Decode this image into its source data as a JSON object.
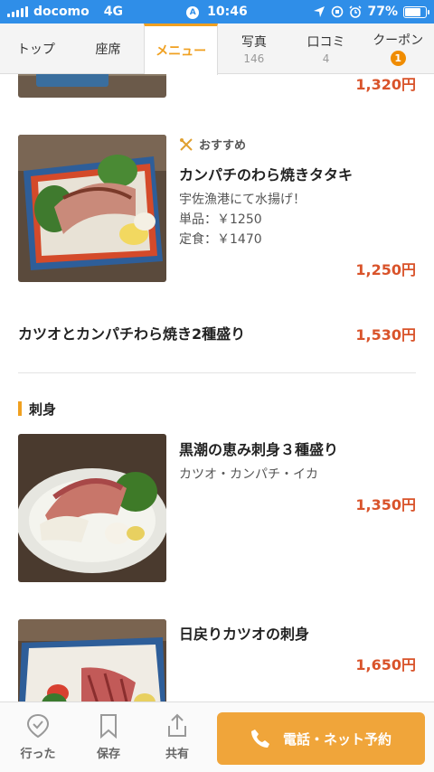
{
  "status": {
    "carrier": "docomo",
    "network": "4G",
    "time": "10:46",
    "battery": "77%",
    "battery_level": 0.77
  },
  "tabs": [
    {
      "label": "トップ",
      "count": ""
    },
    {
      "label": "座席",
      "count": ""
    },
    {
      "label": "メニュー",
      "count": ""
    },
    {
      "label": "写真",
      "count": "146"
    },
    {
      "label": "口コミ",
      "count": "4"
    },
    {
      "label": "クーポン",
      "badge": "1"
    }
  ],
  "menu": {
    "prev_item_price": "1,320円",
    "item1": {
      "tag": "おすすめ",
      "title": "カンパチのわら焼きタタキ",
      "desc1": "宇佐漁港にて水揚げ！",
      "desc2": "単品：￥1250",
      "desc3": "定食：￥1470",
      "price": "1,250円"
    },
    "item2": {
      "title": "カツオとカンパチわら焼き2種盛り",
      "price": "1,530円"
    },
    "section": "刺身",
    "item3": {
      "title": "黒潮の恵み刺身３種盛り",
      "desc": "カツオ・カンパチ・イカ",
      "price": "1,350円"
    },
    "item4": {
      "title": "日戻りカツオの刺身",
      "price": "1,650円"
    }
  },
  "bottom": {
    "visited": "行った",
    "save": "保存",
    "share": "共有",
    "call": "電話・ネット予約"
  }
}
